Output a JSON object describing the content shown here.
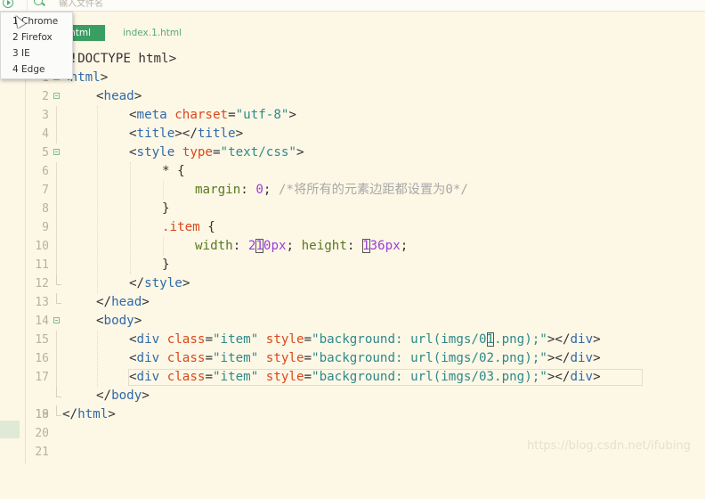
{
  "toolbar": {
    "search_placeholder": "输入文件名"
  },
  "tabs": [
    {
      "label": "html",
      "active": true
    },
    {
      "label": "index.1.html",
      "active": false
    }
  ],
  "browser_menu": {
    "items": [
      {
        "label": "1 Chrome"
      },
      {
        "label": "2 Firefox"
      },
      {
        "label": "3 IE"
      },
      {
        "label": "4 Edge"
      }
    ]
  },
  "editor": {
    "current_line": 18,
    "lines": [
      {
        "n": "1",
        "text": "<!DOCTYPE html>"
      },
      {
        "n": "2",
        "text": "<html>"
      },
      {
        "n": "3",
        "text": "<head>"
      },
      {
        "n": "4",
        "text": "<meta charset=\"utf-8\">"
      },
      {
        "n": "5",
        "text": "<title></title>"
      },
      {
        "n": "6",
        "text": "<style type=\"text/css\">"
      },
      {
        "n": "7",
        "text": "* {"
      },
      {
        "n": "8",
        "text": "margin: 0; /*将所有的元素边距都设置为0*/"
      },
      {
        "n": "9",
        "text": "}"
      },
      {
        "n": "10",
        "text": ".item {"
      },
      {
        "n": "11",
        "text": "width: 210px; height: 136px;"
      },
      {
        "n": "12",
        "text": "}"
      },
      {
        "n": "13",
        "text": "</style>"
      },
      {
        "n": "14",
        "text": "</head>"
      },
      {
        "n": "15",
        "text": "<body>"
      },
      {
        "n": "16",
        "text": "<div class=\"item\" style=\"background: url(imgs/01.png);\"></div>"
      },
      {
        "n": "17",
        "text": "<div class=\"item\" style=\"background: url(imgs/02.png);\"></div>"
      },
      {
        "n": "18",
        "text": "<div class=\"item\" style=\"background: url(imgs/03.png);\"></div>"
      },
      {
        "n": "19",
        "text": "</body>"
      },
      {
        "n": "20",
        "text": "</html>"
      },
      {
        "n": "21",
        "text": ""
      }
    ],
    "tokens": {
      "l1": [
        "<!DOCTYPE html>"
      ],
      "l2": [
        "<",
        "html",
        ">"
      ],
      "l3": [
        "<",
        "head",
        ">"
      ],
      "l4": [
        "<",
        "meta",
        " ",
        "charset",
        "=",
        "\"utf-8\"",
        ">"
      ],
      "l5": [
        "<",
        "title",
        "></",
        "title",
        ">"
      ],
      "l6": [
        "<",
        "style",
        " ",
        "type",
        "=",
        "\"text/css\"",
        ">"
      ],
      "l7": [
        "* {"
      ],
      "l8": [
        "margin",
        ": ",
        "0",
        "; ",
        "/*将所有的元素边距都设置为0*/"
      ],
      "l9": [
        "}"
      ],
      "l10": [
        ".item",
        " {"
      ],
      "l11": [
        "width",
        ": ",
        "2",
        "1",
        "0px",
        "; ",
        "height",
        ": ",
        "1",
        "36px",
        ";"
      ],
      "l12": [
        "}"
      ],
      "l13": [
        "</",
        "style",
        ">"
      ],
      "l14": [
        "</",
        "head",
        ">"
      ],
      "l15": [
        "<",
        "body",
        ">"
      ],
      "l16": [
        "<",
        "div",
        " ",
        "class",
        "=",
        "\"item\"",
        " ",
        "style",
        "=",
        "\"background: url(imgs/0",
        "1",
        ".png);\"",
        "></",
        "div",
        ">"
      ],
      "l17": [
        "<",
        "div",
        " ",
        "class",
        "=",
        "\"item\"",
        " ",
        "style",
        "=",
        "\"background: url(imgs/02.png);\"",
        "></",
        "div",
        ">"
      ],
      "l18": [
        "<",
        "div",
        " ",
        "class",
        "=",
        "\"item\"",
        " ",
        "style",
        "=",
        "\"background: url(imgs/03.png);\"",
        "></",
        "div",
        ">"
      ],
      "l19": [
        "</",
        "body",
        ">"
      ],
      "l20": [
        "</",
        "html",
        ">"
      ]
    }
  },
  "watermark": "https://blog.csdn.net/ifubing"
}
